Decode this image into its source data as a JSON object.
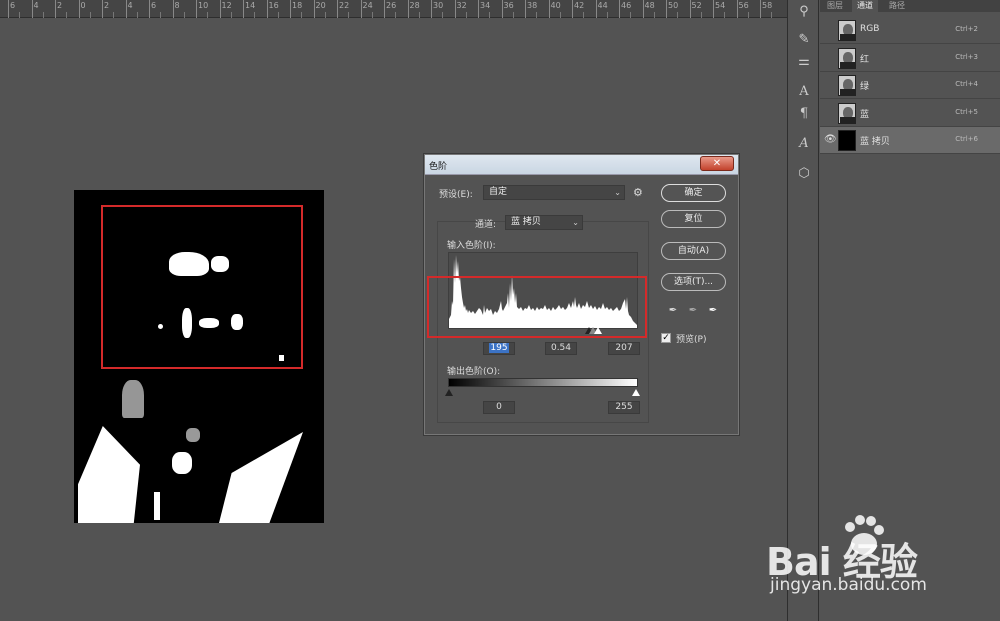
{
  "ruler": {
    "ticks": [
      "6",
      "4",
      "2",
      "0",
      "2",
      "4",
      "6",
      "8",
      "10",
      "12",
      "14",
      "16",
      "18",
      "20",
      "22",
      "24",
      "26",
      "28",
      "30",
      "32",
      "34",
      "36",
      "38",
      "40",
      "42",
      "44",
      "46",
      "48",
      "50",
      "52",
      "54",
      "56",
      "58"
    ]
  },
  "panel": {
    "tabs": [
      "图层",
      "通道",
      "路径"
    ],
    "active_tab": "通道",
    "channels": [
      {
        "name": "RGB",
        "shortcut": "Ctrl+2",
        "visible": false,
        "selected": false
      },
      {
        "name": "红",
        "shortcut": "Ctrl+3",
        "visible": false,
        "selected": false
      },
      {
        "name": "绿",
        "shortcut": "Ctrl+4",
        "visible": false,
        "selected": false
      },
      {
        "name": "蓝",
        "shortcut": "Ctrl+5",
        "visible": false,
        "selected": false
      },
      {
        "name": "蓝 拷贝",
        "shortcut": "Ctrl+6",
        "visible": true,
        "selected": true
      }
    ]
  },
  "dialog": {
    "title": "色阶",
    "preset_label": "预设(E):",
    "preset_value": "自定",
    "channel_label": "通道:",
    "channel_value": "蓝 拷贝",
    "input_levels_label": "输入色阶(I):",
    "input_black": "195",
    "input_gamma": "0.54",
    "input_white": "207",
    "output_levels_label": "输出色阶(O):",
    "output_black": "0",
    "output_white": "255",
    "buttons": {
      "ok": "确定",
      "reset": "复位",
      "auto": "自动(A)",
      "options": "选项(T)..."
    },
    "preview_label": "预览(P)",
    "preview_checked": true,
    "close_glyph": "✕"
  },
  "watermark": {
    "brand": "Bai  经验",
    "url": "jingyan.baidu.com"
  },
  "colors": {
    "accent_red": "#d42a2a",
    "selection_blue": "#3c73c5",
    "bg": "#535353"
  }
}
